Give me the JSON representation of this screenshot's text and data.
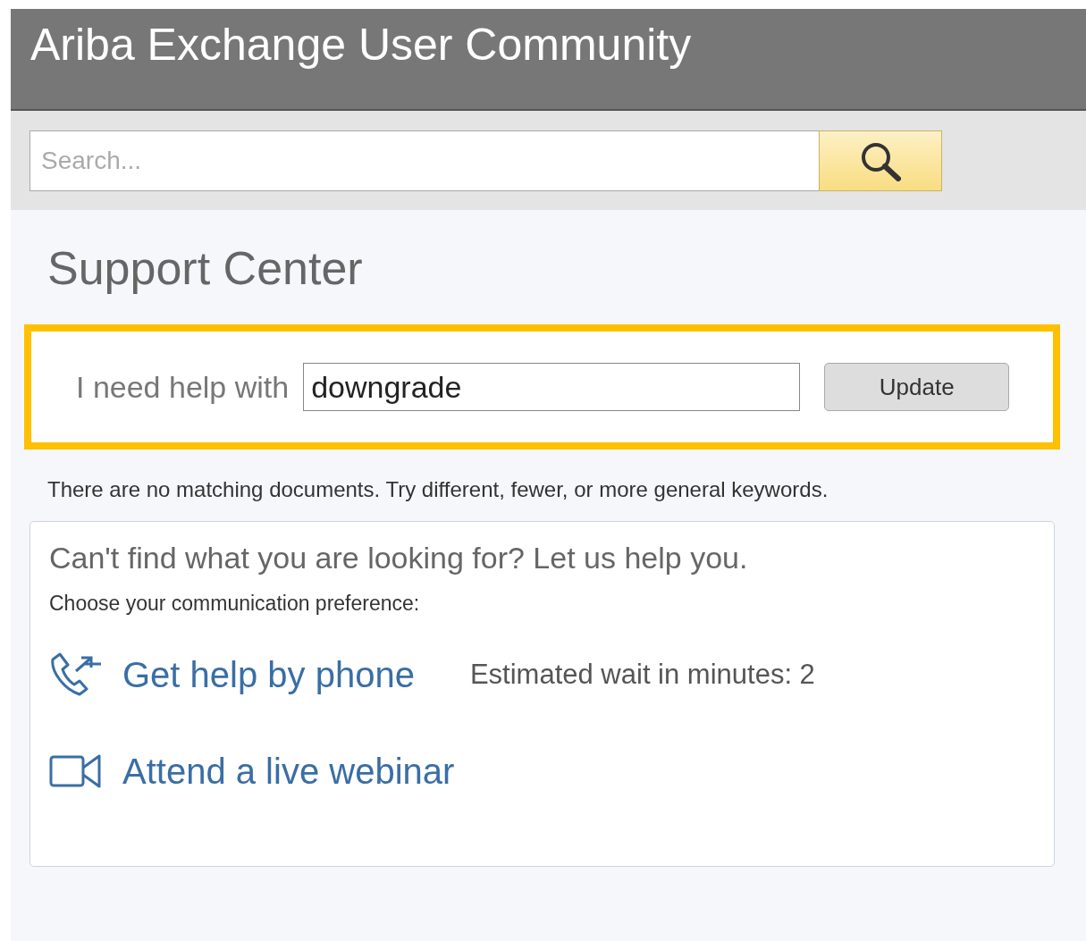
{
  "header": {
    "title": "Ariba Exchange User Community"
  },
  "search": {
    "placeholder": "Search..."
  },
  "page_title": "Support Center",
  "help_form": {
    "label": "I need help with",
    "value": "downgrade",
    "button": "Update"
  },
  "message": "There are no matching documents. Try different, fewer, or more general keywords.",
  "help_card": {
    "heading": "Can't find what you are looking for? Let us help you.",
    "prompt": "Choose your communication preference:",
    "options": [
      {
        "kind": "phone",
        "label": "Get help by phone",
        "note": "Estimated wait in minutes: 2"
      },
      {
        "kind": "webinar",
        "label": "Attend a live webinar"
      }
    ]
  }
}
